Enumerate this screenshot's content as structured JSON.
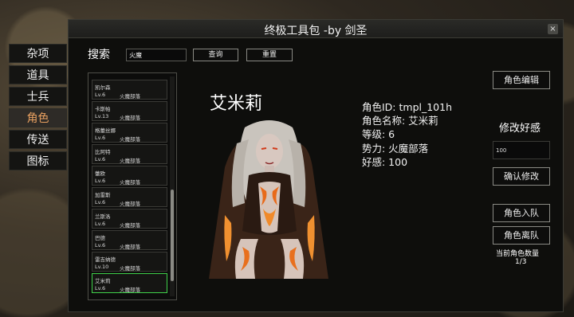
{
  "window": {
    "title": "终极工具包 -by 剑圣",
    "close_glyph": "×"
  },
  "side_menu": [
    {
      "label": "杂项",
      "active": false
    },
    {
      "label": "道具",
      "active": false
    },
    {
      "label": "士兵",
      "active": false
    },
    {
      "label": "角色",
      "active": true
    },
    {
      "label": "传送",
      "active": false
    },
    {
      "label": "图标",
      "active": false
    }
  ],
  "search": {
    "label": "搜索",
    "value": "火魔",
    "query_label": "查询",
    "reset_label": "重置"
  },
  "character_list": [
    {
      "name": "凯尔森",
      "level": "Lv.6",
      "faction": "火魔部落"
    },
    {
      "name": "卡斯帕",
      "level": "Lv.13",
      "faction": "火魔部落"
    },
    {
      "name": "格蕾丝娜",
      "level": "Lv.6",
      "faction": "火魔部落"
    },
    {
      "name": "比阿特",
      "level": "Lv.6",
      "faction": "火魔部落"
    },
    {
      "name": "蕾欧",
      "level": "Lv.6",
      "faction": "火魔部落"
    },
    {
      "name": "加雷斯",
      "level": "Lv.6",
      "faction": "火魔部落"
    },
    {
      "name": "兰斯洛",
      "level": "Lv.6",
      "faction": "火魔部落"
    },
    {
      "name": "巴德",
      "level": "Lv.6",
      "faction": "火魔部落"
    },
    {
      "name": "雷吉纳德",
      "level": "Lv.10",
      "faction": "火魔部落"
    },
    {
      "name": "艾米莉",
      "level": "Lv.6",
      "faction": "火魔部落",
      "selected": true
    }
  ],
  "character": {
    "display_name": "艾米莉",
    "id_line": "角色ID: tmpl_101h",
    "name_line": "角色名称: 艾米莉",
    "level_line": "等级: 6",
    "faction_line": "势力: 火魔部落",
    "affinity_line": "好感: 100"
  },
  "actions": {
    "edit_label": "角色编辑",
    "edit_affinity_label": "修改好感",
    "affinity_value": "100",
    "confirm_label": "确认修改",
    "join_label": "角色入队",
    "leave_label": "角色离队",
    "count_label": "当前角色数量",
    "count_value": "1/3"
  },
  "colors": {
    "active_menu": "#e8a060",
    "selected_border": "#3fd04a"
  }
}
